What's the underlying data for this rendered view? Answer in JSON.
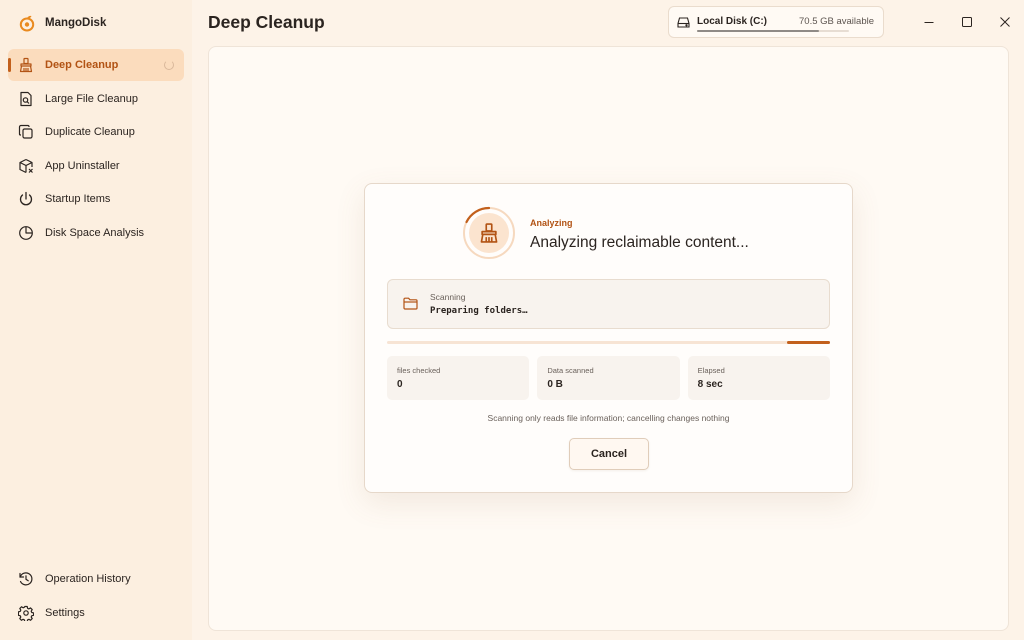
{
  "app": {
    "name": "MangoDisk"
  },
  "sidebar": {
    "items": [
      {
        "label": "Deep Cleanup",
        "icon": "broom-icon",
        "active": true
      },
      {
        "label": "Large File Cleanup",
        "icon": "file-search-icon"
      },
      {
        "label": "Duplicate Cleanup",
        "icon": "duplicate-icon"
      },
      {
        "label": "App Uninstaller",
        "icon": "package-remove-icon"
      },
      {
        "label": "Startup Items",
        "icon": "power-icon"
      },
      {
        "label": "Disk Space Analysis",
        "icon": "pie-chart-icon"
      }
    ],
    "bottom_items": [
      {
        "label": "Operation History",
        "icon": "history-icon"
      },
      {
        "label": "Settings",
        "icon": "gear-icon"
      }
    ]
  },
  "header": {
    "title": "Deep Cleanup",
    "disk": {
      "name": "Local Disk (C:)",
      "available": "70.5 GB available",
      "used_fraction": 0.8
    }
  },
  "dialog": {
    "status_label": "Analyzing",
    "headline": "Analyzing reclaimable content...",
    "scan": {
      "caption": "Scanning",
      "path": "Preparing folders…"
    },
    "stats": [
      {
        "label": "files checked",
        "value": "0"
      },
      {
        "label": "Data scanned",
        "value": "0 B"
      },
      {
        "label": "Elapsed",
        "value": "8 sec"
      }
    ],
    "note": "Scanning only reads file information; cancelling changes nothing",
    "cancel_label": "Cancel"
  },
  "colors": {
    "accent": "#c2601c",
    "accent_text": "#b25314",
    "sidebar_bg": "#fcefe0",
    "active_bg": "#fbdcbd"
  }
}
